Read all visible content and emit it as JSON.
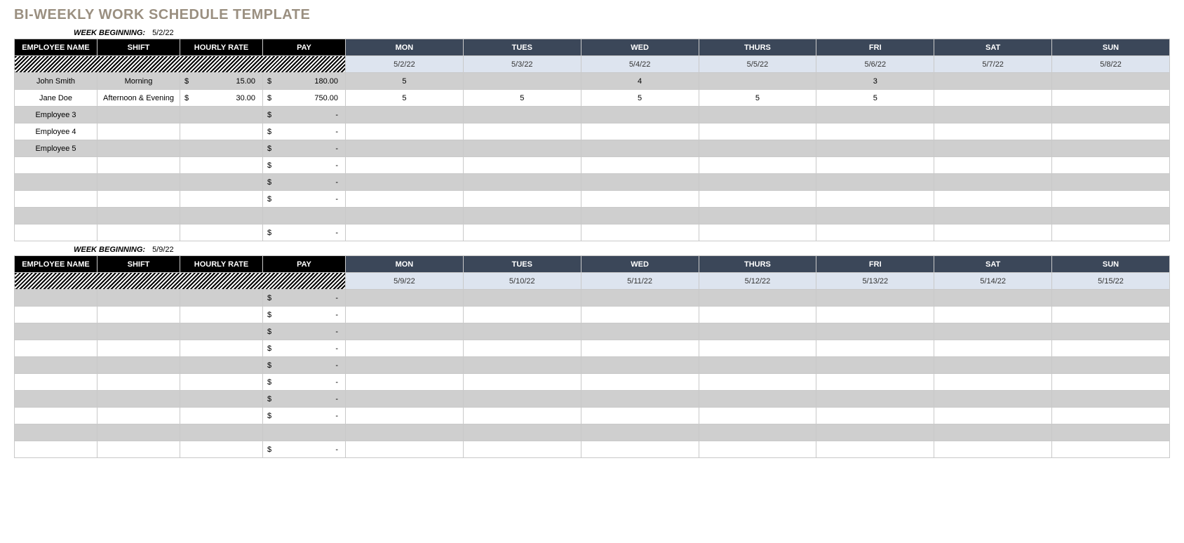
{
  "title": "BI-WEEKLY WORK SCHEDULE TEMPLATE",
  "labels": {
    "week_beginning": "WEEK BEGINNING:",
    "employee_name": "EMPLOYEE NAME",
    "shift": "SHIFT",
    "hourly_rate": "HOURLY RATE",
    "pay": "PAY",
    "days": [
      "MON",
      "TUES",
      "WED",
      "THURS",
      "FRI",
      "SAT",
      "SUN"
    ],
    "currency": "$",
    "dash": "-"
  },
  "weeks": [
    {
      "week_beginning": "5/2/22",
      "dates": [
        "5/2/22",
        "5/3/22",
        "5/4/22",
        "5/5/22",
        "5/6/22",
        "5/7/22",
        "5/8/22"
      ],
      "rows": [
        {
          "name": "John Smith",
          "shift": "Morning",
          "rate": "15.00",
          "pay": "180.00",
          "days": [
            "5",
            "",
            "4",
            "",
            "3",
            "",
            ""
          ]
        },
        {
          "name": "Jane Doe",
          "shift": "Afternoon & Evening",
          "rate": "30.00",
          "pay": "750.00",
          "days": [
            "5",
            "5",
            "5",
            "5",
            "5",
            "",
            ""
          ]
        },
        {
          "name": "Employee 3",
          "shift": "",
          "rate": "",
          "pay": "-",
          "days": [
            "",
            "",
            "",
            "",
            "",
            "",
            ""
          ]
        },
        {
          "name": "Employee 4",
          "shift": "",
          "rate": "",
          "pay": "-",
          "days": [
            "",
            "",
            "",
            "",
            "",
            "",
            ""
          ]
        },
        {
          "name": "Employee 5",
          "shift": "",
          "rate": "",
          "pay": "-",
          "days": [
            "",
            "",
            "",
            "",
            "",
            "",
            ""
          ]
        },
        {
          "name": "",
          "shift": "",
          "rate": "",
          "pay": "-",
          "days": [
            "",
            "",
            "",
            "",
            "",
            "",
            ""
          ]
        },
        {
          "name": "",
          "shift": "",
          "rate": "",
          "pay": "-",
          "days": [
            "",
            "",
            "",
            "",
            "",
            "",
            ""
          ]
        },
        {
          "name": "",
          "shift": "",
          "rate": "",
          "pay": "-",
          "days": [
            "",
            "",
            "",
            "",
            "",
            "",
            ""
          ]
        },
        {
          "name": "",
          "shift": "",
          "rate": "",
          "pay": "",
          "days": [
            "",
            "",
            "",
            "",
            "",
            "",
            ""
          ]
        },
        {
          "name": "",
          "shift": "",
          "rate": "",
          "pay": "-",
          "days": [
            "",
            "",
            "",
            "",
            "",
            "",
            ""
          ]
        }
      ]
    },
    {
      "week_beginning": "5/9/22",
      "dates": [
        "5/9/22",
        "5/10/22",
        "5/11/22",
        "5/12/22",
        "5/13/22",
        "5/14/22",
        "5/15/22"
      ],
      "rows": [
        {
          "name": "",
          "shift": "",
          "rate": "",
          "pay": "-",
          "days": [
            "",
            "",
            "",
            "",
            "",
            "",
            ""
          ]
        },
        {
          "name": "",
          "shift": "",
          "rate": "",
          "pay": "-",
          "days": [
            "",
            "",
            "",
            "",
            "",
            "",
            ""
          ]
        },
        {
          "name": "",
          "shift": "",
          "rate": "",
          "pay": "-",
          "days": [
            "",
            "",
            "",
            "",
            "",
            "",
            ""
          ]
        },
        {
          "name": "",
          "shift": "",
          "rate": "",
          "pay": "-",
          "days": [
            "",
            "",
            "",
            "",
            "",
            "",
            ""
          ]
        },
        {
          "name": "",
          "shift": "",
          "rate": "",
          "pay": "-",
          "days": [
            "",
            "",
            "",
            "",
            "",
            "",
            ""
          ]
        },
        {
          "name": "",
          "shift": "",
          "rate": "",
          "pay": "-",
          "days": [
            "",
            "",
            "",
            "",
            "",
            "",
            ""
          ]
        },
        {
          "name": "",
          "shift": "",
          "rate": "",
          "pay": "-",
          "days": [
            "",
            "",
            "",
            "",
            "",
            "",
            ""
          ]
        },
        {
          "name": "",
          "shift": "",
          "rate": "",
          "pay": "-",
          "days": [
            "",
            "",
            "",
            "",
            "",
            "",
            ""
          ]
        },
        {
          "name": "",
          "shift": "",
          "rate": "",
          "pay": "",
          "days": [
            "",
            "",
            "",
            "",
            "",
            "",
            ""
          ]
        },
        {
          "name": "",
          "shift": "",
          "rate": "",
          "pay": "-",
          "days": [
            "",
            "",
            "",
            "",
            "",
            "",
            ""
          ]
        }
      ]
    }
  ]
}
